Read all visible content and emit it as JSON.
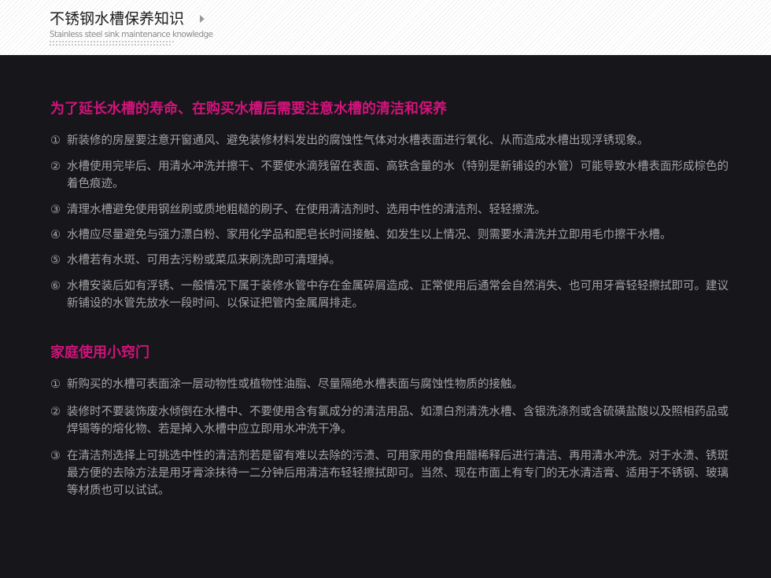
{
  "header": {
    "title": "不锈钢水槽保养知识",
    "subtitle": "Stainless steel sink maintenance knowledge"
  },
  "sections": [
    {
      "heading": "为了延长水槽的寿命、在购买水槽后需要注意水槽的清洁和保养",
      "items": [
        {
          "num": "①",
          "text": "新装修的房屋要注意开窗通风、避免装修材料发出的腐蚀性气体对水槽表面进行氧化、从而造成水槽出现浮锈现象。"
        },
        {
          "num": "②",
          "text": "水槽使用完毕后、用清水冲洗并擦干、不要使水滴残留在表面、高铁含量的水（特别是新铺设的水管）可能导致水槽表面形成棕色的着色痕迹。"
        },
        {
          "num": "③",
          "text": "清理水槽避免使用钢丝刷或质地粗糙的刷子、在使用清洁剂时、选用中性的清洁剂、轻轻擦洗。"
        },
        {
          "num": "④",
          "text": "水槽应尽量避免与强力漂白粉、家用化学品和肥皂长时间接触、如发生以上情况、则需要水清洗并立即用毛巾擦干水槽。"
        },
        {
          "num": "⑤",
          "text": "水槽若有水斑、可用去污粉或菜瓜来刷洗即可清理掉。"
        },
        {
          "num": "⑥",
          "text": "水槽安装后如有浮锈、一般情况下属于装修水管中存在金属碎屑造成、正常使用后通常会自然消失、也可用牙膏轻轻擦拭即可。建议新铺设的水管先放水一段时间、以保证把管内金属屑排走。"
        }
      ]
    },
    {
      "heading": "家庭使用小窍门",
      "items": [
        {
          "num": "①",
          "text": "新购买的水槽可表面涂一层动物性或植物性油脂、尽量隔绝水槽表面与腐蚀性物质的接触。"
        },
        {
          "num": "②",
          "text": "装修时不要装饰废水倾倒在水槽中、不要使用含有氯成分的清洁用品、如漂白剂清洗水槽、含银洗涤剂或含硫磺盐酸以及照相药品或焊锡等的熔化物、若是掉入水槽中应立即用水冲洗干净。"
        },
        {
          "num": "③",
          "text": "在清洁剂选择上可挑选中性的清洁剂若是留有难以去除的污渍、可用家用的食用醋稀释后进行清洁、再用清水冲洗。对于水渍、锈斑最方便的去除方法是用牙膏涂抹待一二分钟后用清洁布轻轻擦拭即可。当然、现在市面上有专门的无水清洁膏、适用于不锈钢、玻璃等材质也可以试试。"
        }
      ]
    }
  ]
}
